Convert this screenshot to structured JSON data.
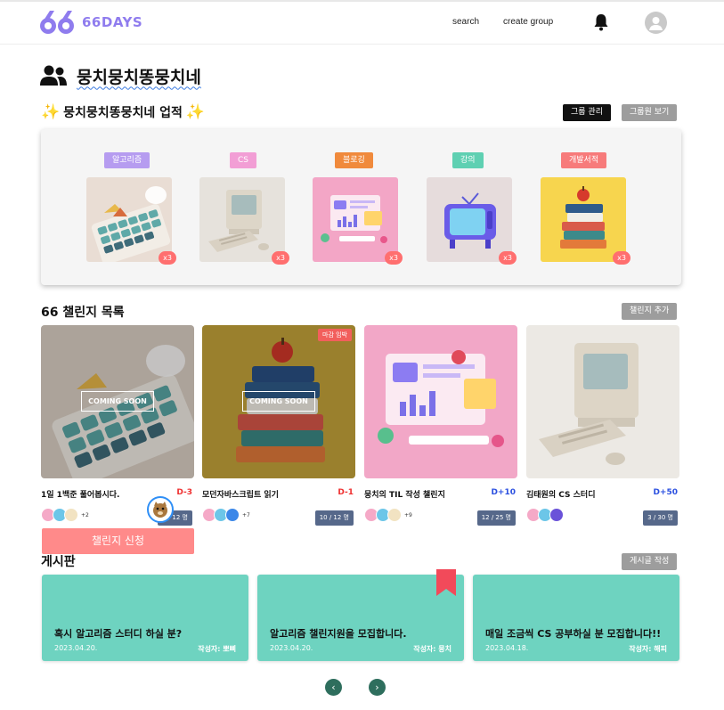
{
  "header": {
    "logo_text": "66DAYS",
    "nav": {
      "search": "search",
      "create_group": "create group"
    }
  },
  "group": {
    "name": "뭉치뭉치똥뭉치네"
  },
  "achievements": {
    "heading": "뭉치뭉치똥뭉치네 업적",
    "manage_label": "그룹 관리",
    "members_label": "그룹원 보기",
    "items": [
      {
        "tag": "알고리즘",
        "count": "x3",
        "tag_color": "#b69cf0"
      },
      {
        "tag": "CS",
        "count": "x3",
        "tag_color": "#f29ed5"
      },
      {
        "tag": "블로깅",
        "count": "x3",
        "tag_color": "#f08a3c"
      },
      {
        "tag": "강의",
        "count": "x3",
        "tag_color": "#5fd0b2"
      },
      {
        "tag": "개발서적",
        "count": "x3",
        "tag_color": "#f77b7b"
      }
    ]
  },
  "challenges": {
    "title": "66 챌린지 목록",
    "add_label": "챌린지 추가",
    "apply_label": "챌린지 신청",
    "coming_soon": "COMING SOON",
    "deadline_badge": "마감 임박",
    "items": [
      {
        "name": "1일 1백준 풀어봅시다.",
        "dday": "D-3",
        "dday_color": "#ef2f2f",
        "more": "+2",
        "participants": "2 / 12 명"
      },
      {
        "name": "모던자바스크립트 읽기",
        "dday": "D-1",
        "dday_color": "#ef2f2f",
        "more": "+7",
        "participants": "10 / 12 명"
      },
      {
        "name": "뭉치의 TIL 작성 챌린지",
        "dday": "D+10",
        "dday_color": "#2a4fe0",
        "more": "+9",
        "participants": "12 / 25 명"
      },
      {
        "name": "김태원의 CS 스터디",
        "dday": "D+50",
        "dday_color": "#2a4fe0",
        "more": "",
        "participants": "3 / 30 명"
      }
    ]
  },
  "board": {
    "title": "게시판",
    "write_label": "게시글 작성",
    "posts": [
      {
        "title": "혹시 알고리즘 스터디 하실 분?",
        "date": "2023.04.20.",
        "author": "작성자: 뽀삐"
      },
      {
        "title": "알고리즘 챌린지원을 모집합니다.",
        "date": "2023.04.20.",
        "author": "작성자: 뭉치"
      },
      {
        "title": "매일 조금씩 CS 공부하실 분 모집합니다!!",
        "date": "2023.04.18.",
        "author": "작성자: 해피"
      }
    ]
  },
  "pagination": {
    "prev": "‹",
    "next": "›"
  },
  "icons": {
    "logo": "logo-66-icon",
    "bell": "bell-icon",
    "avatar": "user-avatar-icon",
    "group": "group-people-icon",
    "sparkle": "sparkle-icon",
    "bookmark": "bookmark-icon"
  }
}
